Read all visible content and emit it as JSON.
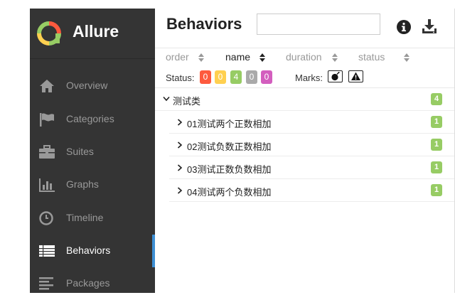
{
  "app": {
    "title": "Allure"
  },
  "sidebar": {
    "items": [
      {
        "label": "Overview",
        "icon": "home-icon"
      },
      {
        "label": "Categories",
        "icon": "flag-icon"
      },
      {
        "label": "Suites",
        "icon": "briefcase-icon"
      },
      {
        "label": "Graphs",
        "icon": "bar-chart-icon"
      },
      {
        "label": "Timeline",
        "icon": "clock-icon"
      },
      {
        "label": "Behaviors",
        "icon": "list-icon",
        "active": true
      },
      {
        "label": "Packages",
        "icon": "align-left-icon"
      }
    ]
  },
  "header": {
    "title": "Behaviors",
    "search": {
      "value": "",
      "placeholder": ""
    }
  },
  "sort": {
    "columns": [
      {
        "label": "order",
        "active": false
      },
      {
        "label": "name",
        "active": true
      },
      {
        "label": "duration",
        "active": false
      },
      {
        "label": "status",
        "active": false
      }
    ]
  },
  "status_filter": {
    "label": "Status:",
    "badges": [
      {
        "value": "0",
        "color": "#fd5a3e"
      },
      {
        "value": "0",
        "color": "#ffd050"
      },
      {
        "value": "4",
        "color": "#97cc64"
      },
      {
        "value": "0",
        "color": "#aaaaaa"
      },
      {
        "value": "0",
        "color": "#d35ebe"
      }
    ]
  },
  "marks": {
    "label": "Marks:",
    "icons": [
      "bomb-icon",
      "warning-icon"
    ]
  },
  "tree": {
    "group": {
      "label": "测试类",
      "count": "4"
    },
    "items": [
      {
        "label": "01测试两个正数相加",
        "count": "1"
      },
      {
        "label": "02测试负数正数相加",
        "count": "1"
      },
      {
        "label": "03测试正数负数相加",
        "count": "1"
      },
      {
        "label": "04测试两个负数相加",
        "count": "1"
      }
    ]
  },
  "colors": {
    "sidebar_bg": "#343434",
    "accent": "#3d8fd4",
    "passed": "#97cc64"
  }
}
